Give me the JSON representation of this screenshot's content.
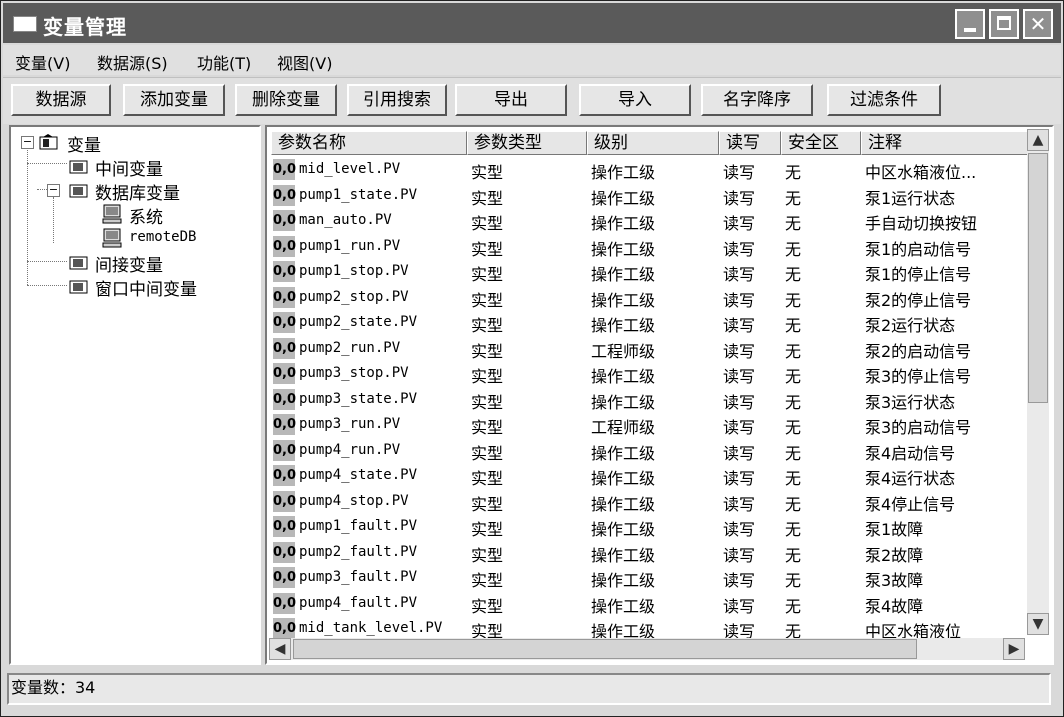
{
  "window": {
    "title": "变量管理"
  },
  "menu": [
    "变量(V)",
    "数据源(S)",
    "功能(T)",
    "视图(V)"
  ],
  "toolbar": [
    "数据源",
    "添加变量",
    "删除变量",
    "引用搜索",
    "导出",
    "导入",
    "名字降序",
    "过滤条件"
  ],
  "tree": {
    "root": "变量",
    "items": [
      "中间变量",
      "数据库变量",
      "系统",
      "remoteDB",
      "间接变量",
      "窗口中间变量"
    ]
  },
  "table": {
    "columns": [
      "参数名称",
      "参数类型",
      "级别",
      "读写",
      "安全区",
      "注释"
    ],
    "quality": "0,0",
    "rows": [
      [
        "mid_level.PV",
        "实型",
        "操作工级",
        "读写",
        "无",
        "中区水箱液位..."
      ],
      [
        "pump1_state.PV",
        "实型",
        "操作工级",
        "读写",
        "无",
        "泵1运行状态"
      ],
      [
        "man_auto.PV",
        "实型",
        "操作工级",
        "读写",
        "无",
        "手自动切换按钮"
      ],
      [
        "pump1_run.PV",
        "实型",
        "操作工级",
        "读写",
        "无",
        "泵1的启动信号"
      ],
      [
        "pump1_stop.PV",
        "实型",
        "操作工级",
        "读写",
        "无",
        "泵1的停止信号"
      ],
      [
        "pump2_stop.PV",
        "实型",
        "操作工级",
        "读写",
        "无",
        "泵2的停止信号"
      ],
      [
        "pump2_state.PV",
        "实型",
        "操作工级",
        "读写",
        "无",
        "泵2运行状态"
      ],
      [
        "pump2_run.PV",
        "实型",
        "工程师级",
        "读写",
        "无",
        "泵2的启动信号"
      ],
      [
        "pump3_stop.PV",
        "实型",
        "操作工级",
        "读写",
        "无",
        "泵3的停止信号"
      ],
      [
        "pump3_state.PV",
        "实型",
        "操作工级",
        "读写",
        "无",
        "泵3运行状态"
      ],
      [
        "pump3_run.PV",
        "实型",
        "工程师级",
        "读写",
        "无",
        "泵3的启动信号"
      ],
      [
        "pump4_run.PV",
        "实型",
        "操作工级",
        "读写",
        "无",
        "泵4启动信号"
      ],
      [
        "pump4_state.PV",
        "实型",
        "操作工级",
        "读写",
        "无",
        "泵4运行状态"
      ],
      [
        "pump4_stop.PV",
        "实型",
        "操作工级",
        "读写",
        "无",
        "泵4停止信号"
      ],
      [
        "pump1_fault.PV",
        "实型",
        "操作工级",
        "读写",
        "无",
        "泵1故障"
      ],
      [
        "pump2_fault.PV",
        "实型",
        "操作工级",
        "读写",
        "无",
        "泵2故障"
      ],
      [
        "pump3_fault.PV",
        "实型",
        "操作工级",
        "读写",
        "无",
        "泵3故障"
      ],
      [
        "pump4_fault.PV",
        "实型",
        "操作工级",
        "读写",
        "无",
        "泵4故障"
      ],
      [
        "mid_tank_level.PV",
        "实型",
        "操作工级",
        "读写",
        "无",
        "中区水箱液位"
      ]
    ]
  },
  "status": {
    "label": "变量数：34"
  }
}
